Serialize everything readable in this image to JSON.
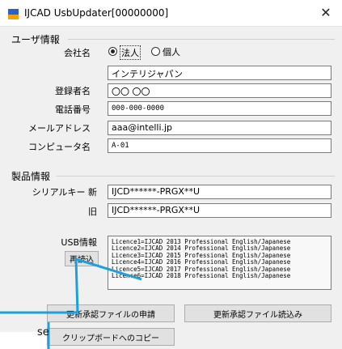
{
  "window": {
    "title": "IJCAD UsbUpdater[00000000]",
    "close_glyph": "✕",
    "icon": "app-icon"
  },
  "user_info": {
    "group_label": "ユーザ情報",
    "company_label": "会社名",
    "radio_corporate": "法人",
    "radio_individual": "個人",
    "company_value": "インテリジャパン",
    "registrant_label": "登録者名",
    "registrant_value": "〇〇 〇〇",
    "phone_label": "電話番号",
    "phone_value": "000-000-0000",
    "email_label": "メールアドレス",
    "email_value": "aaa@intelli.jp",
    "computer_label": "コンピュータ名",
    "computer_value": "A-01"
  },
  "product_info": {
    "group_label": "製品情報",
    "serial_new_label": "シリアルキー 新",
    "serial_new_value": "IJCD******-PRGX**U",
    "serial_old_label": "旧",
    "serial_old_value": "IJCD******-PRGX**U"
  },
  "usb": {
    "label": "USB情報",
    "reload_button": "再読込",
    "licences": [
      "Licence1=IJCAD 2013 Professional English/Japanese",
      "Licence2=IJCAD 2014 Professional English/Japanese",
      "Licence3=IJCAD 2015 Professional English/Japanese",
      "Licence4=IJCAD 2016 Professional English/Japanese",
      "Licence5=IJCAD 2017 Professional English/Japanese",
      "Licence6=IJCAD 2018 Professional English/Japanese"
    ]
  },
  "buttons": {
    "apply_update": "更新承認ファイルの申請",
    "load_update": "更新承認ファイル読込み",
    "copy_clipboard": "クリップボードへのコピー"
  },
  "callout": {
    "partial_text": "se",
    "color": "#1ea0dc"
  }
}
